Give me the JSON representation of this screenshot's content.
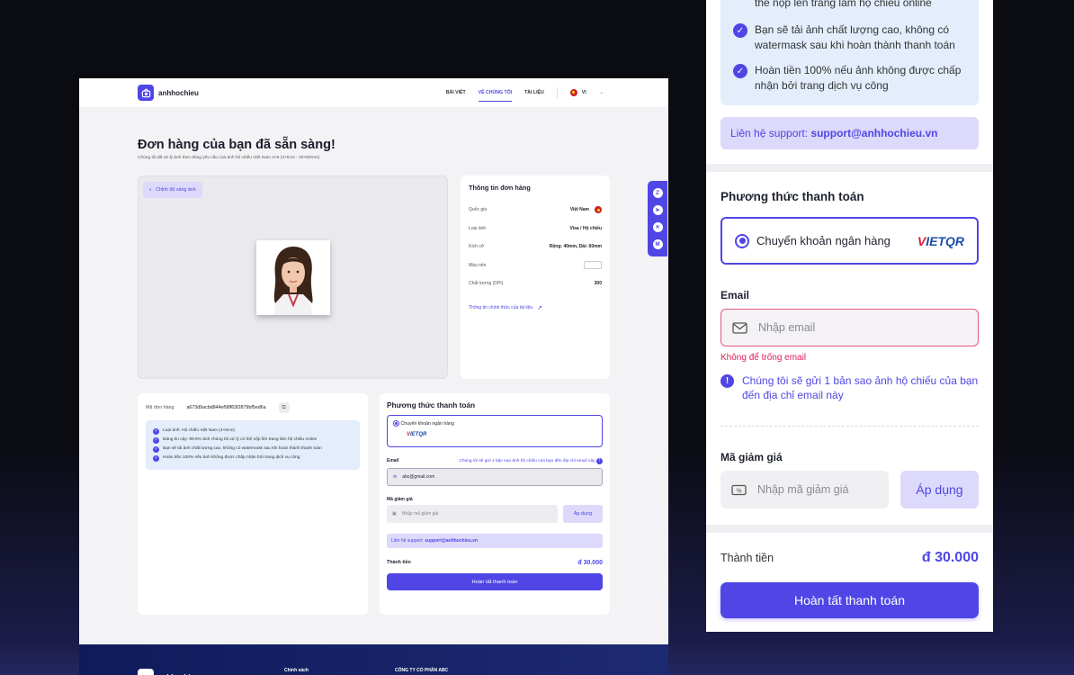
{
  "nav": {
    "brand": "anhhochieu",
    "links": [
      "BÀI VIẾT",
      "VỀ CHÚNG TÔI",
      "TÀI LIỆU"
    ],
    "lang": "VI"
  },
  "page": {
    "title": "Đơn hàng của bạn đã sẵn sàng!",
    "subtitle": "Chúng tôi đã xử lý ảnh theo đúng yêu cầu của ảnh hộ chiếu Việt Nam 4×6 (4×6cm - 40×60mm)"
  },
  "image_panel": {
    "brightness_button": "Chỉnh độ sáng ảnh"
  },
  "order_info": {
    "title": "Thông tin đơn hàng",
    "rows": [
      {
        "label": "Quốc gia",
        "value": "Việt Nam"
      },
      {
        "label": "Loại ảnh",
        "value": "Visa / Hộ chiếu"
      },
      {
        "label": "Kích cỡ",
        "value": "Rộng: 40mm, Dài: 60mm"
      },
      {
        "label": "Màu nền",
        "value": ""
      },
      {
        "label": "Chất lượng (DPI)",
        "value": "300"
      }
    ],
    "link": "Thông tin chính thức của tài liệu"
  },
  "share_icons": [
    "zalo-icon",
    "telegram-icon",
    "x-icon",
    "gmail-icon"
  ],
  "order": {
    "code_label": "Mã đơn hàng",
    "code": "a673d9acbd844ef98f63f2879bf5ed6a",
    "features": [
      "Loại ảnh: Hộ chiếu Việt Nam (4×6cm)",
      "Đáng tin cậy: 99.5% ảnh chúng tôi xử lý có thể nộp lên trang làm hộ chiếu online",
      "Bạn sẽ tải ảnh chất lượng cao, không có watermask sau khi hoàn thành thanh toán",
      "Hoàn tiền 100% nếu ảnh không được chấp nhận bởi trang dịch vụ công"
    ]
  },
  "payment_small": {
    "title": "Phương thức thanh toán",
    "bank": "Chuyển khoản ngân hàng",
    "email_label": "Email",
    "email_note": "Chúng tôi sẽ gửi 1 bản sao ảnh hộ chiếu của bạn đến địa chỉ email này",
    "email_value": "abc@gmail.com",
    "code_label": "Mã giảm giá",
    "code_placeholder": "Nhập mã giảm giá",
    "apply": "Áp dụng",
    "support_prefix": "Liên hệ support:",
    "support_email": "support@anhhochieu.vn",
    "total_label": "Thành tiền",
    "total": "đ 30.000",
    "submit": "Hoàn tất thanh toán"
  },
  "footer": {
    "brand": "anhhochieu",
    "col1": "Chính sách",
    "col2": "CÔNG TY CỔ PHẦN ABC"
  },
  "mobile": {
    "feature_lines": [
      "thể nộp lên trang làm hộ chiếu online",
      "Bạn sẽ tải ảnh chất lượng cao, không có watermask sau khi hoàn thành thanh toán",
      "Hoàn tiền 100% nếu ảnh không được chấp nhận bởi trang dịch vụ công"
    ],
    "support_prefix": "Liên hệ support:",
    "support_email": "support@anhhochieu.vn",
    "payment_title": "Phương thức thanh toán",
    "bank": "Chuyển khoản ngân hàng",
    "vietqr": "VIETQR",
    "email_label": "Email",
    "email_placeholder": "Nhập email",
    "email_error": "Không để trống email",
    "email_note": "Chúng tôi sẽ gửi 1 bản sao ảnh hộ chiếu của bạn đến địa chỉ email này",
    "code_label": "Mã giảm giá",
    "code_placeholder": "Nhập mã giảm giá",
    "apply": "Áp dụng",
    "total_label": "Thành tiền",
    "total": "đ 30.000",
    "submit": "Hoàn tất thanh toán"
  }
}
